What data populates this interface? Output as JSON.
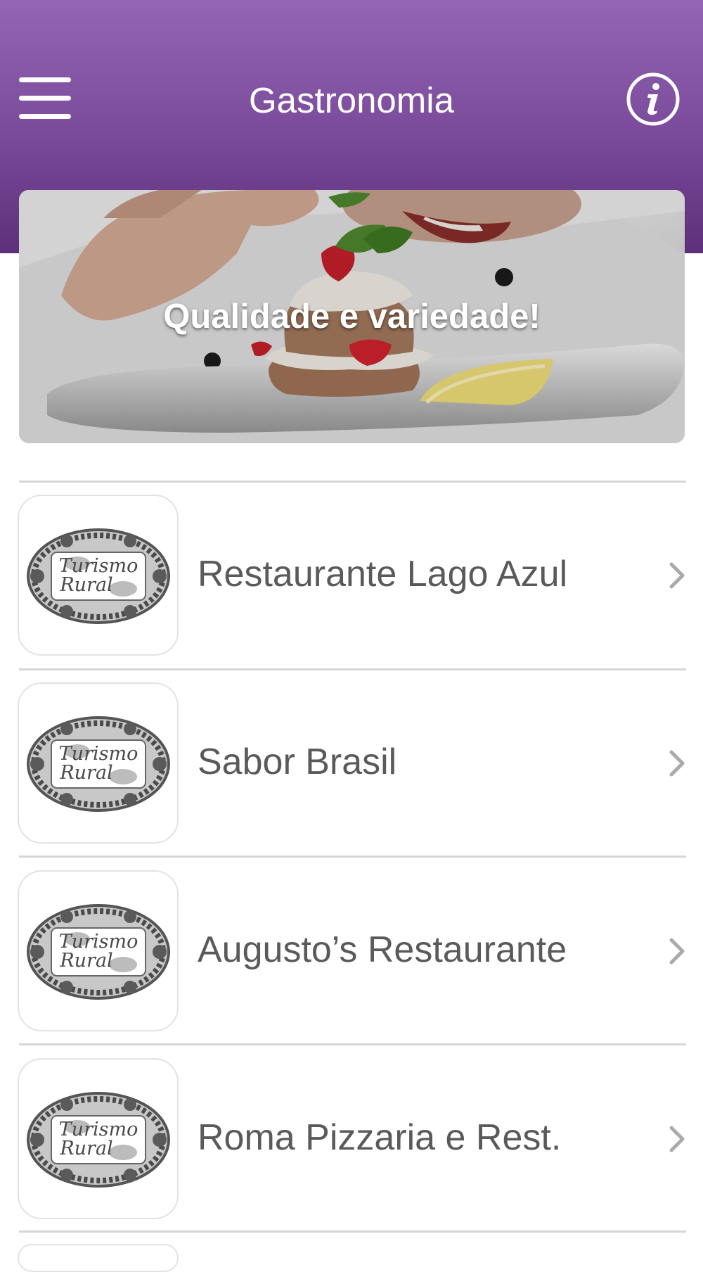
{
  "header": {
    "title": "Gastronomia",
    "menu_icon": "hamburger-menu-icon",
    "info_icon": "info-icon",
    "colors": {
      "gradient_top": "#9465b2",
      "gradient_bottom": "#5e2f7a"
    }
  },
  "banner": {
    "caption": "Qualidade e variedade!"
  },
  "restaurants": [
    {
      "name": "Restaurante Lago Azul",
      "logo_text": "Turismo Rural"
    },
    {
      "name": "Sabor Brasil",
      "logo_text": "Turismo Rural"
    },
    {
      "name": "Augusto’s Restaurante",
      "logo_text": "Turismo Rural"
    },
    {
      "name": "Roma Pizzaria e Rest.",
      "logo_text": "Turismo Rural"
    }
  ],
  "list_icons": {
    "chevron": "chevron-right-icon"
  }
}
